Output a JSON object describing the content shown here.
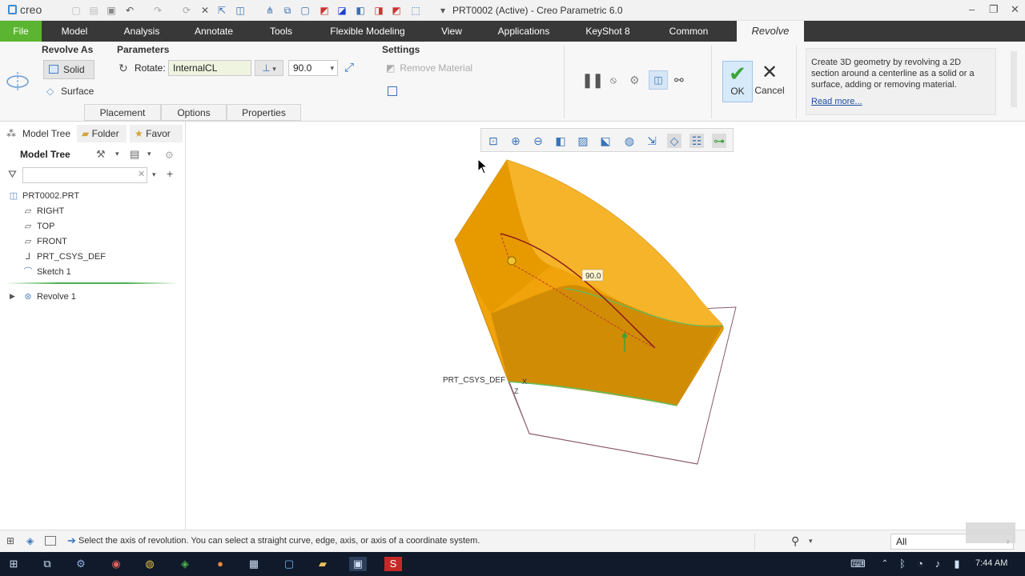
{
  "window": {
    "app_name": "creo",
    "title": "PRT0002 (Active) - Creo Parametric 6.0"
  },
  "ribbon_tabs": [
    "File",
    "Model",
    "Analysis",
    "Annotate",
    "Tools",
    "Flexible Modeling",
    "View",
    "Applications",
    "KeyShot 8",
    "Common",
    "Revolve"
  ],
  "revolve_as": {
    "title": "Revolve As",
    "solid_label": "Solid",
    "surface_label": "Surface"
  },
  "parameters": {
    "title": "Parameters",
    "rotate_label": "Rotate:",
    "axis_value": "InternalCL",
    "angle_value": "90.0"
  },
  "settings": {
    "title": "Settings",
    "remove_material_label": "Remove Material"
  },
  "subtabs": [
    "Placement",
    "Options",
    "Properties"
  ],
  "actions": {
    "ok_label": "OK",
    "cancel_label": "Cancel"
  },
  "help": {
    "text": "Create 3D geometry by revolving a 2D section around a centerline as a solid or a surface, adding or removing material.",
    "link": "Read more..."
  },
  "left_panel": {
    "tabs": [
      "Model Tree",
      "Folder",
      "Favor"
    ],
    "header": "Model Tree",
    "items": [
      {
        "label": "PRT0002.PRT",
        "icon": "part-icon"
      },
      {
        "label": "RIGHT",
        "icon": "datum-plane-icon"
      },
      {
        "label": "TOP",
        "icon": "datum-plane-icon"
      },
      {
        "label": "FRONT",
        "icon": "datum-plane-icon"
      },
      {
        "label": "PRT_CSYS_DEF",
        "icon": "csys-icon"
      },
      {
        "label": "Sketch 1",
        "icon": "sketch-icon"
      },
      {
        "label": "Revolve 1",
        "icon": "revolve-icon"
      }
    ]
  },
  "graphics": {
    "dimension_label": "90.0",
    "csys_label": "PRT_CSYS_DEF",
    "axis_labels": [
      "X",
      "Z"
    ]
  },
  "status": {
    "message": "Select the axis of revolution. You can select a straight curve, edge, axis, or axis of a coordinate system.",
    "filter_value": "All"
  },
  "taskbar": {
    "clock": "7:44 AM"
  },
  "colors": {
    "file_tab": "#5cb531",
    "ribbon_dark": "#383838",
    "model_orange": "#f0a30a"
  }
}
